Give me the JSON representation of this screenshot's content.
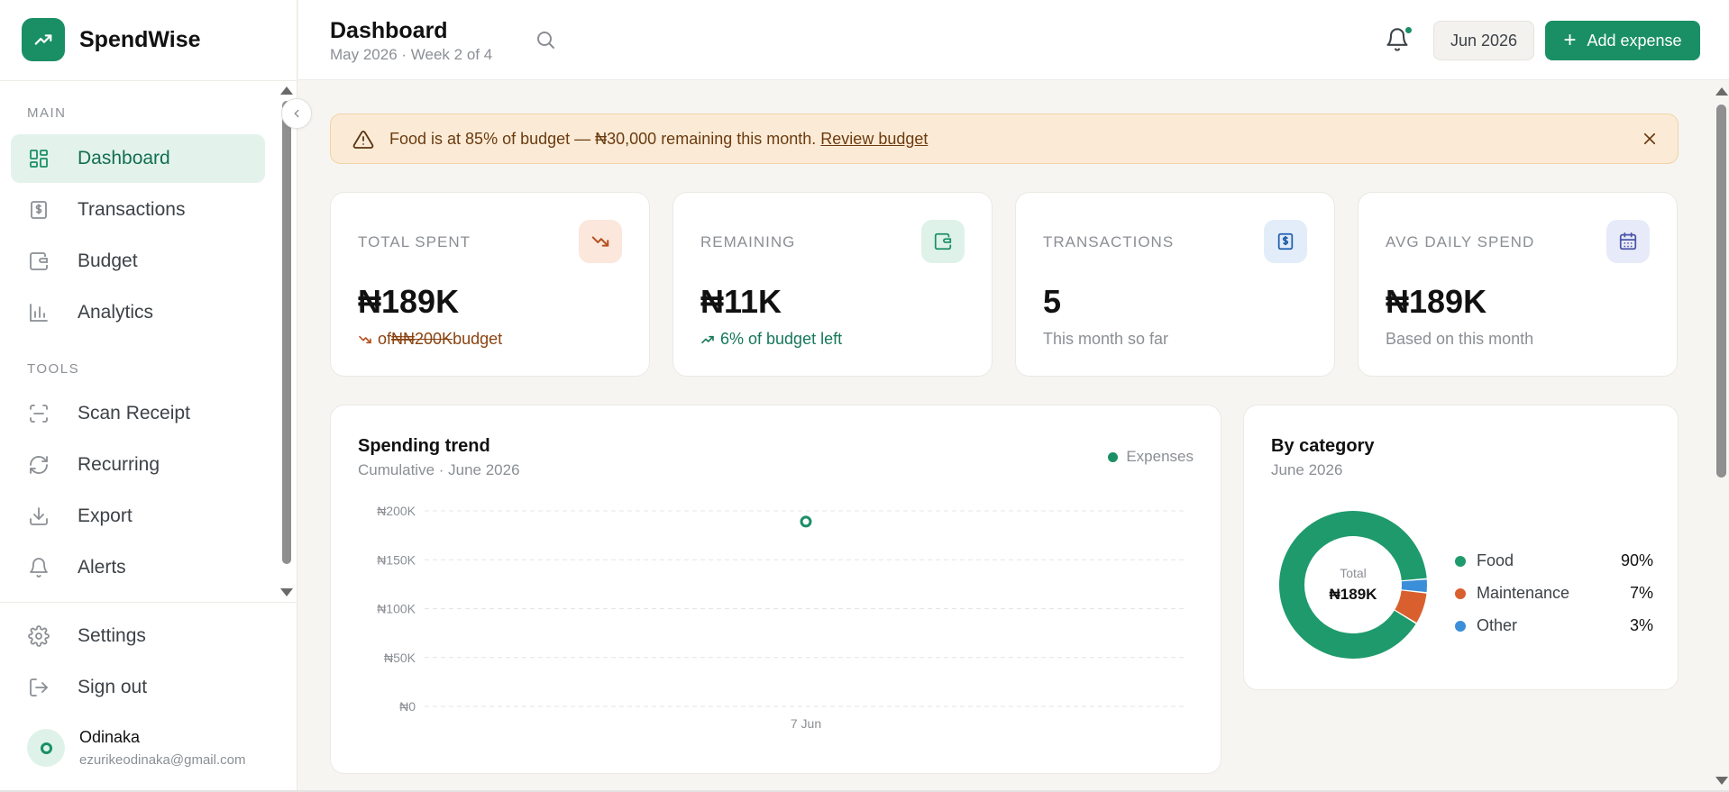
{
  "app": {
    "name": "SpendWise"
  },
  "sidebar": {
    "main_label": "MAIN",
    "tools_label": "TOOLS",
    "items": [
      {
        "label": "Dashboard",
        "icon": "grid-icon",
        "active": true
      },
      {
        "label": "Transactions",
        "icon": "dollar-doc-icon"
      },
      {
        "label": "Budget",
        "icon": "wallet-icon"
      },
      {
        "label": "Analytics",
        "icon": "bar-chart-icon"
      }
    ],
    "tools": [
      {
        "label": "Scan Receipt",
        "icon": "scan-icon"
      },
      {
        "label": "Recurring",
        "icon": "refresh-icon"
      },
      {
        "label": "Export",
        "icon": "download-icon"
      },
      {
        "label": "Alerts",
        "icon": "bell-icon"
      }
    ],
    "footer": [
      {
        "label": "Settings",
        "icon": "gear-icon"
      },
      {
        "label": "Sign out",
        "icon": "logout-icon"
      }
    ],
    "user": {
      "name": "Odinaka",
      "email": "ezurikeodinaka@gmail.com"
    }
  },
  "header": {
    "title": "Dashboard",
    "subtitle": "May 2026 · Week 2 of 4",
    "month": "Jun 2026",
    "add_label": "Add expense"
  },
  "alert": {
    "text": "Food is at 85% of budget — ₦30,000 remaining this month.",
    "link": "Review budget"
  },
  "stats": [
    {
      "label": "TOTAL SPENT",
      "value": "₦189K",
      "sub_prefix": "of ",
      "sub_strike": "₦₦200K",
      "sub_suffix": " budget",
      "icon": "trend-down-icon"
    },
    {
      "label": "REMAINING",
      "value": "₦11K",
      "sub": "6% of budget left",
      "icon": "wallet-icon"
    },
    {
      "label": "TRANSACTIONS",
      "value": "5",
      "sub": "This month so far",
      "icon": "dollar-doc-icon"
    },
    {
      "label": "AVG DAILY SPEND",
      "value": "₦189K",
      "sub": "Based on this month",
      "icon": "calendar-icon"
    }
  ],
  "trend": {
    "title": "Spending trend",
    "subtitle": "Cumulative · June 2026",
    "legend": "Expenses"
  },
  "category": {
    "title": "By category",
    "subtitle": "June 2026",
    "total_label": "Total",
    "total_value": "₦189K"
  },
  "colors": {
    "accent": "#1a8f66",
    "food": "#1f9a6c",
    "maintenance": "#d9602e",
    "other": "#3b8fd9"
  },
  "chart_data": [
    {
      "type": "line",
      "title": "Spending trend",
      "subtitle": "Cumulative · June 2026",
      "xlabel": "",
      "ylabel": "",
      "series": [
        {
          "name": "Expenses",
          "x": [
            "7 Jun"
          ],
          "values": [
            189000
          ]
        }
      ],
      "ylim": [
        0,
        200000
      ],
      "yticks": [
        0,
        50000,
        100000,
        150000,
        200000
      ],
      "ytick_labels": [
        "₦0",
        "₦50K",
        "₦100K",
        "₦150K",
        "₦200K"
      ],
      "xtick_labels": [
        "7 Jun"
      ],
      "grid": true,
      "legend": "top-right"
    },
    {
      "type": "pie",
      "title": "By category",
      "subtitle": "June 2026",
      "categories": [
        "Food",
        "Maintenance",
        "Other"
      ],
      "values": [
        90,
        7,
        3
      ],
      "value_labels": [
        "90%",
        "7%",
        "3%"
      ],
      "legend": "right"
    }
  ]
}
